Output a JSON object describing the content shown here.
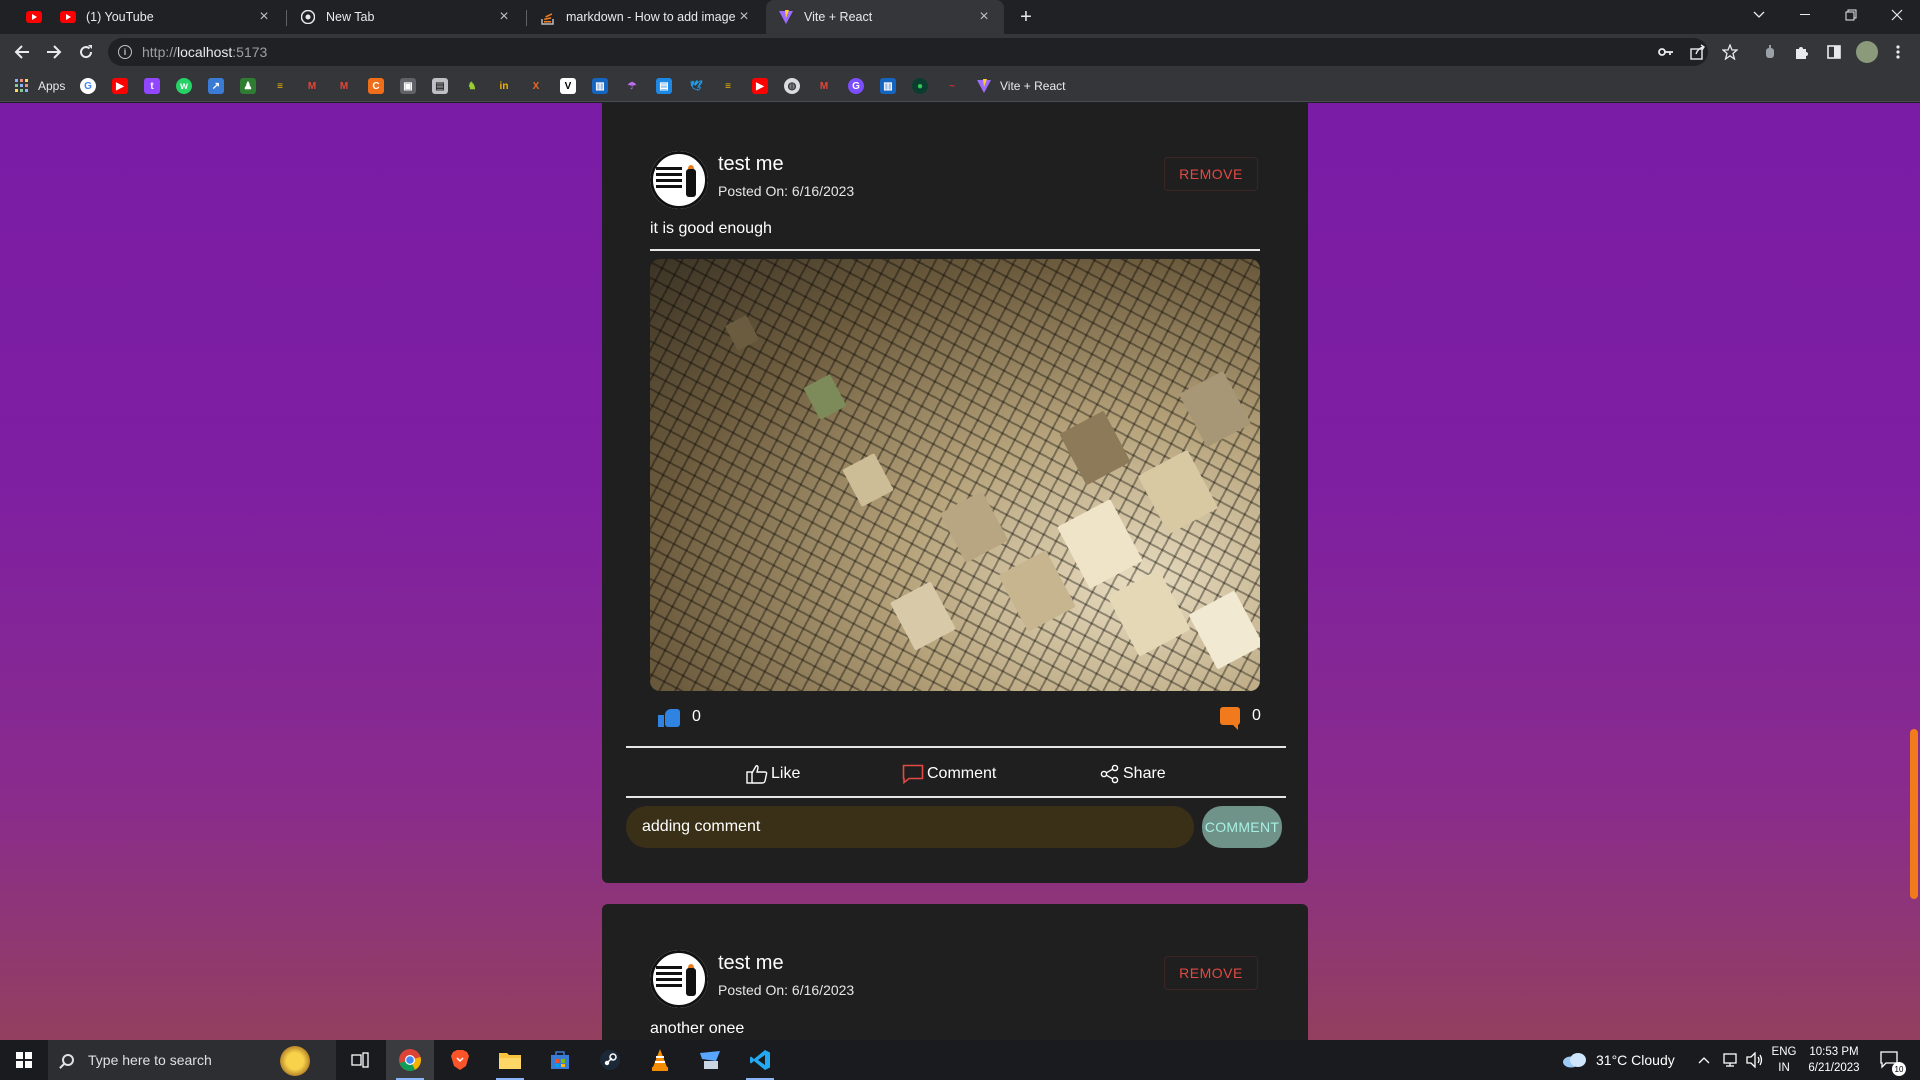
{
  "browser": {
    "tabs": [
      {
        "title": "(1) YouTube",
        "icon": "youtube-icon",
        "color": "#ff0000"
      },
      {
        "title": "New Tab",
        "icon": "chrome-icon",
        "color": "#e8eaed"
      },
      {
        "title": "markdown - How to add images",
        "icon": "stackoverflow-icon",
        "color": "#f48024"
      },
      {
        "title": "Vite + React",
        "icon": "vite-icon",
        "color": "#9d6cff"
      }
    ],
    "url_scheme": "http://",
    "url_host": "localhost",
    "url_port": ":5173",
    "bookmarks": {
      "apps_label": "Apps",
      "last_label": "Vite + React"
    }
  },
  "page": {
    "accent": "#f07a1c",
    "posts": [
      {
        "author": "test me",
        "posted_on": "Posted On: 6/16/2023",
        "remove_label": "REMOVE",
        "text": "it is good enough",
        "likes": "0",
        "comments": "0",
        "actions": {
          "like": "Like",
          "comment": "Comment",
          "share": "Share"
        },
        "comment_input_value": "adding comment",
        "comment_button": "COMMENT"
      },
      {
        "author": "test me",
        "posted_on": "Posted On: 6/16/2023",
        "remove_label": "REMOVE",
        "text": "another onee"
      }
    ]
  },
  "taskbar": {
    "search_placeholder": "Type here to search",
    "weather": "31°C  Cloudy",
    "lang_top": "ENG",
    "lang_bottom": "IN",
    "time": "10:53 PM",
    "date": "6/21/2023",
    "notification_count": "10"
  }
}
